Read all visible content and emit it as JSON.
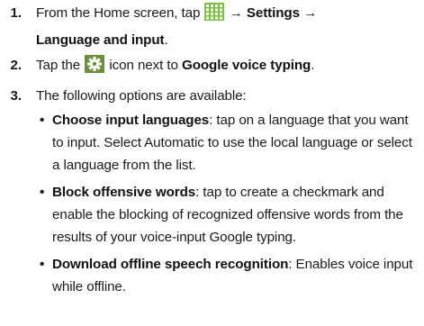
{
  "steps": [
    {
      "number": "1.",
      "text_before": "From the Home screen, tap",
      "icon": "apps-grid-icon",
      "text_after_icon": "Settings",
      "arrow": "→",
      "target": "Language and input",
      "end": "."
    },
    {
      "number": "2.",
      "text_before": "Tap the",
      "icon": "gear-icon",
      "text_after": "icon next to",
      "target": "Google voice typing",
      "end": "."
    },
    {
      "number": "3.",
      "text": "The following options are available:"
    }
  ],
  "options": [
    {
      "bullet": "•",
      "title": "Choose input languages",
      "description": ": tap on a language that you want to input. Select Automatic to use the local language or select a language from the list."
    },
    {
      "bullet": "•",
      "title": "Block offensive words",
      "description": ": tap to create a checkmark and enable the blocking of recognized offensive words from the results of your voice-input Google typing."
    },
    {
      "bullet": "•",
      "title": "Download offline speech recognition",
      "description": ": Enables voice input while offline."
    }
  ],
  "colors": {
    "apps_icon": "#7ac142",
    "gear_icon_bg": "#6b8f3a"
  }
}
